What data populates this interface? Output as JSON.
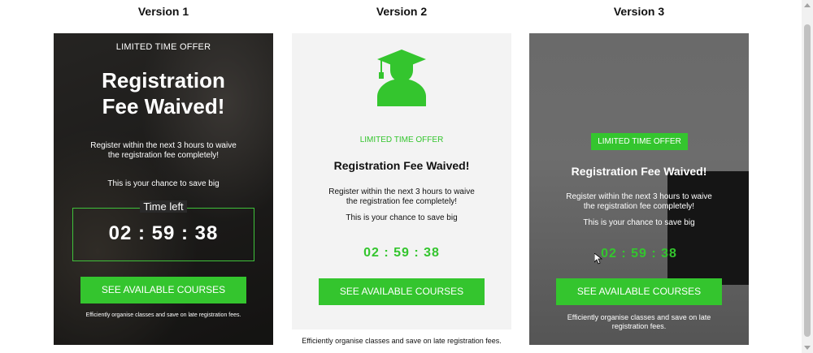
{
  "columns": {
    "v1_title": "Version 1",
    "v2_title": "Version 2",
    "v3_title": "Version 3"
  },
  "offer": {
    "eyebrow": "LIMITED TIME OFFER",
    "headline_v1_line1": "Registration",
    "headline_v1_line2": "Fee Waived!",
    "headline": "Registration Fee Waived!",
    "body_line1": "Register within the next 3 hours to waive",
    "body_line2": "the registration fee completely!",
    "chance": "This is your chance to save big",
    "time_left": "Time left",
    "timer": "02 : 59 : 38",
    "cta": "SEE AVAILABLE COURSES",
    "footer": "Efficiently organise classes and save on late registration fees.",
    "footer_v3_line1": "Efficiently organise classes and save on late",
    "footer_v3_line2": "registration fees."
  },
  "colors": {
    "accent": "#34c52e",
    "v2_background": "#f3f3f3",
    "v3_background": "#6f6f6f"
  },
  "icons": {
    "v2_icon": "graduate-icon",
    "cursor": "mouse-pointer-icon"
  }
}
